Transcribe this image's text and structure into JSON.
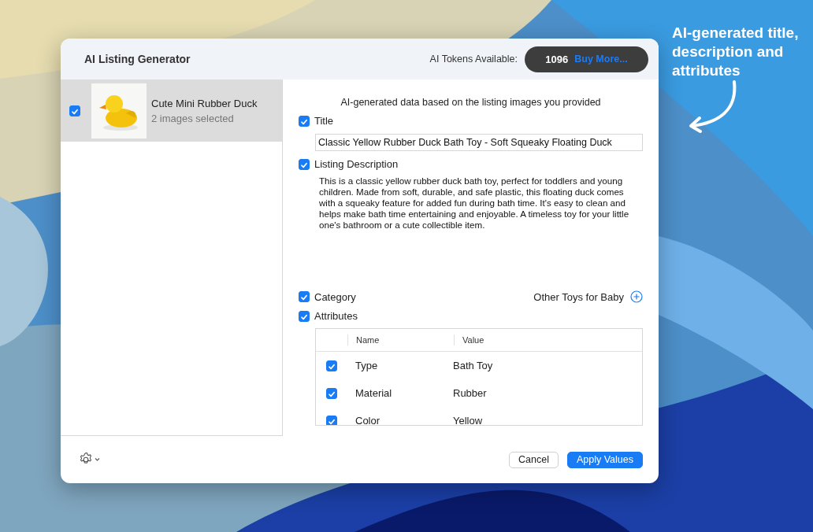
{
  "window": {
    "title": "AI Listing Generator"
  },
  "tokens": {
    "label": "AI Tokens Available:",
    "count": "1096",
    "buy_link": "Buy More..."
  },
  "listings": [
    {
      "title": "Cute Mini Rubber Duck",
      "subtitle": "2 images selected",
      "checked": true,
      "selected": true
    }
  ],
  "intro": "AI-generated data based on the listing images you provided",
  "title_section": {
    "label": "Title",
    "checked": true,
    "value": "Classic Yellow Rubber Duck Bath Toy - Soft Squeaky Floating Duck"
  },
  "description_section": {
    "label": "Listing Description",
    "checked": true,
    "text": "This is a classic yellow rubber duck bath toy, perfect for toddlers and young children. Made from soft, durable, and safe plastic, this floating duck comes with a squeaky feature for added fun during bath time. It's easy to clean and helps make bath time entertaining and enjoyable. A timeless toy for your little one's bathroom or a cute collectible item."
  },
  "category_section": {
    "label": "Category",
    "checked": true,
    "value": "Other Toys for Baby"
  },
  "attributes_section": {
    "label": "Attributes",
    "checked": true,
    "columns": [
      "Name",
      "Value"
    ],
    "rows": [
      {
        "name": "Type",
        "value": "Bath Toy",
        "checked": true
      },
      {
        "name": "Material",
        "value": "Rubber",
        "checked": true
      },
      {
        "name": "Color",
        "value": "Yellow",
        "checked": true
      }
    ]
  },
  "buttons": [
    {
      "label": "Cancel",
      "kind": "secondary"
    },
    {
      "label": "Apply Values",
      "kind": "primary"
    }
  ],
  "annotation": "AI-generated title, description and attributes"
}
